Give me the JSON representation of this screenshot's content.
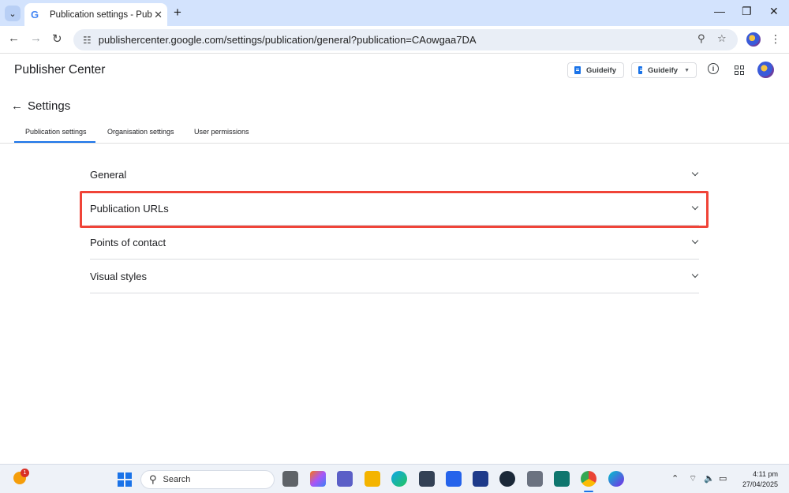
{
  "browser": {
    "tab_title": "Publication settings - Publisher",
    "favicon": "G",
    "url": "publishercenter.google.com/settings/publication/general?publication=CAowgaa7DA",
    "icons": [
      "tab-search-icon",
      "new-tab-icon",
      "minimize-icon",
      "restore-icon",
      "close-icon",
      "back-icon",
      "forward-icon",
      "reload-icon",
      "site-info-icon",
      "zoom-icon",
      "bookmark-star-icon",
      "menu-icon"
    ]
  },
  "header": {
    "app_title": "Publisher Center",
    "publication_button": "Guideify",
    "publication_dropdown": "Guideify"
  },
  "settings": {
    "title": "Settings",
    "tabs": [
      {
        "label": "Publication settings",
        "active": true
      },
      {
        "label": "Organisation settings",
        "active": false
      },
      {
        "label": "User permissions",
        "active": false
      }
    ],
    "sections": [
      {
        "label": "General"
      },
      {
        "label": "Publication URLs",
        "highlighted": true
      },
      {
        "label": "Points of contact"
      },
      {
        "label": "Visual styles"
      }
    ]
  },
  "taskbar": {
    "weather_badge": "1",
    "search_placeholder": "Search",
    "time": "4:11 pm",
    "date": "27/04/2025",
    "colors": {
      "highlight": "#f04438",
      "accent": "#1a73e8"
    }
  }
}
